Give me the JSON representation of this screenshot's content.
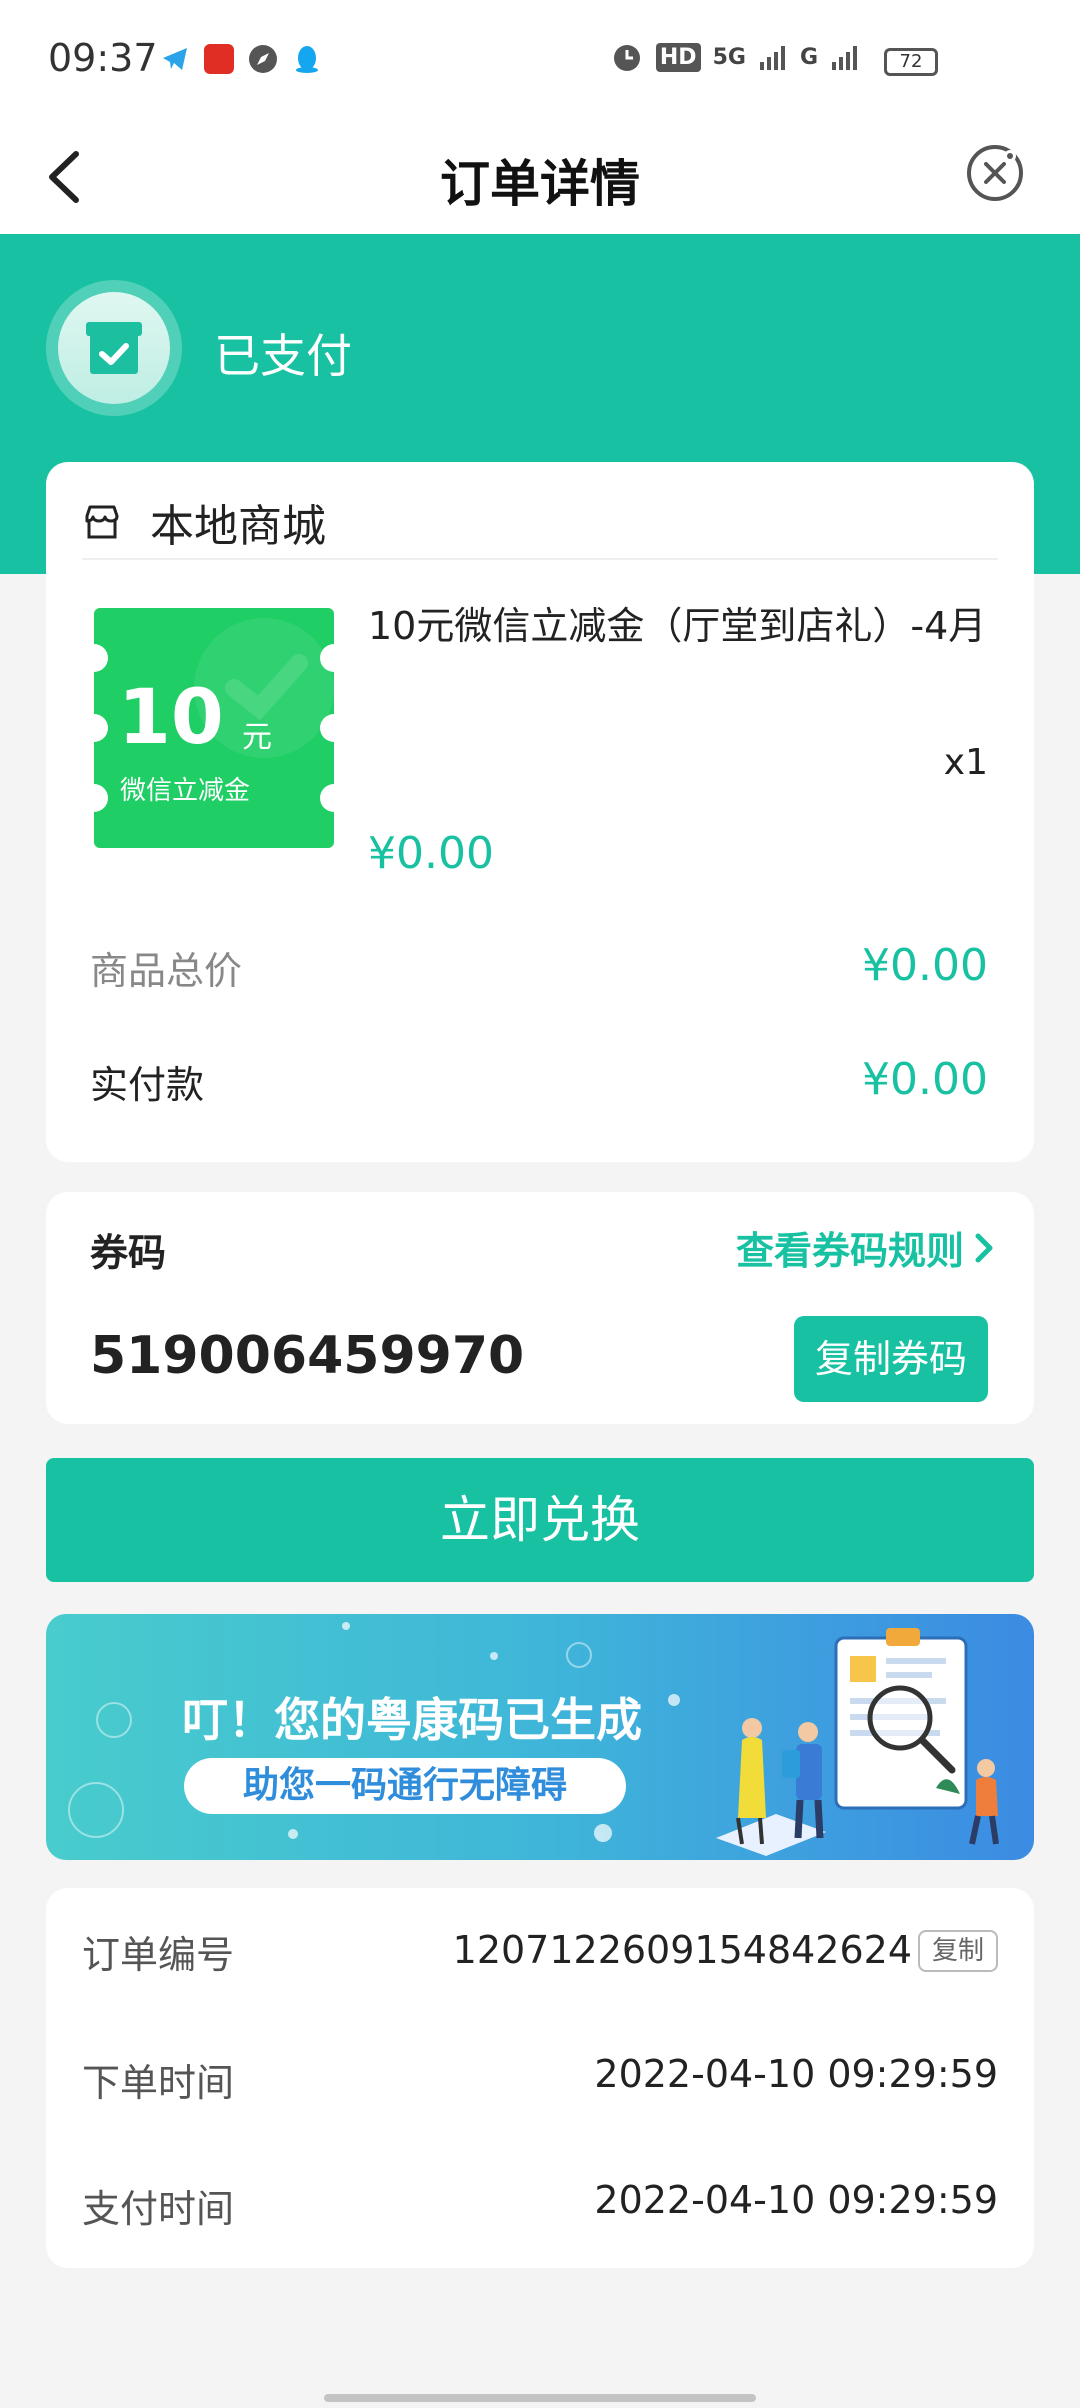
{
  "status_bar": {
    "time": "09:37",
    "network1": "HD",
    "network2": "5G",
    "network3": "G",
    "battery": "72",
    "icons": [
      "telegram-icon",
      "pinduoduo-icon",
      "compass-icon",
      "qq-icon",
      "alarm-icon"
    ]
  },
  "nav": {
    "title": "订单详情",
    "back_icon": "chevron-left-icon",
    "close_icon": "close-circle-icon"
  },
  "order_status": {
    "text": "已支付",
    "icon": "box-check-icon"
  },
  "shop": {
    "name": "本地商城",
    "icon": "store-icon"
  },
  "product": {
    "voucher_amount": "10",
    "voucher_unit": "元",
    "voucher_caption": "微信立减金",
    "name": "10元微信立减金（厅堂到店礼）-4月",
    "quantity": "x1",
    "price": "¥0.00"
  },
  "summary": {
    "total_label": "商品总价",
    "total_value": "¥0.00",
    "paid_label": "实付款",
    "paid_value": "¥0.00"
  },
  "coupon": {
    "label": "券码",
    "rules_link": "查看券码规则",
    "code": "519006459970",
    "copy_button": "复制券码"
  },
  "redeem_button": "立即兑换",
  "banner": {
    "title": "叮！您的粤康码已生成",
    "subtitle": "助您一码通行无障碍"
  },
  "order_info": {
    "order_no_label": "订单编号",
    "order_no_value": "1207122609154842624",
    "copy_label": "复制",
    "order_time_label": "下单时间",
    "order_time_value": "2022-04-10 09:29:59",
    "pay_time_label": "支付时间",
    "pay_time_value": "2022-04-10 09:29:59"
  },
  "colors": {
    "accent": "#17c1a2",
    "voucher": "#1fce64"
  }
}
